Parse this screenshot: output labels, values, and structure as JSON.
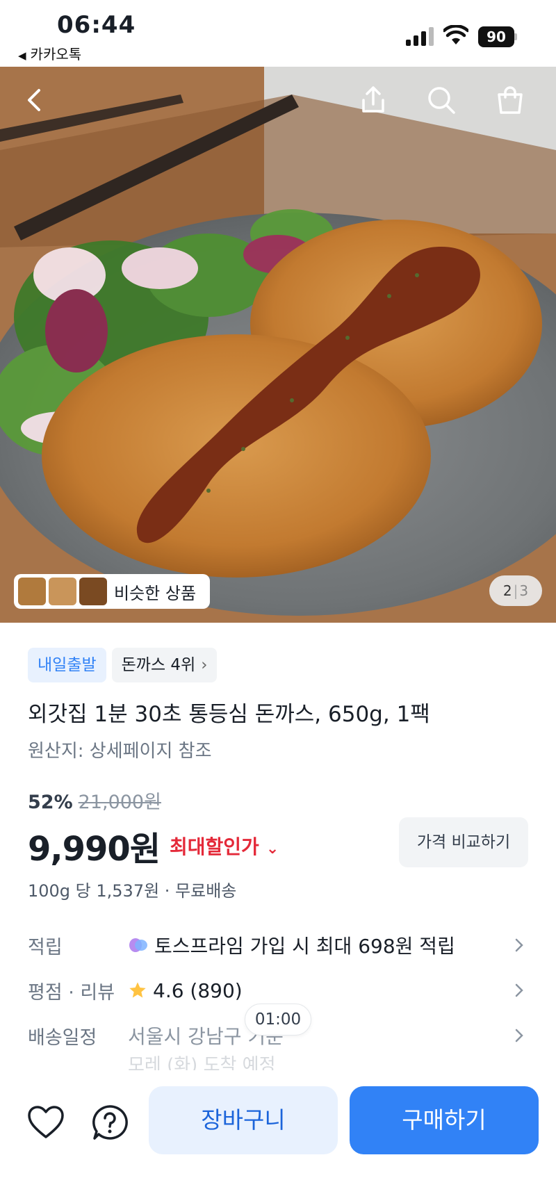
{
  "status_bar": {
    "time": "06:44",
    "back_app": "카카오톡",
    "battery": "90"
  },
  "hero": {
    "icons": [
      "back-arrow-icon",
      "share-icon",
      "search-icon",
      "shopping-bag-icon"
    ],
    "similar_label": "비슷한 상품",
    "page_current": "2",
    "page_total": "3"
  },
  "product": {
    "badge_delivery": "내일출발",
    "badge_rank": "돈까스 4위",
    "title": "외갓집 1분 30초 통등심 돈까스, 650g, 1팩",
    "origin": "원산지: 상세페이지 참조",
    "discount_pct": "52%",
    "original_price": "21,000원",
    "price": "9,990원",
    "lowest_label": "최대할인가",
    "compare_label": "가격 비교하기",
    "unit_price": "100g 당 1,537원 · 무료배송"
  },
  "info": {
    "points_label": "적립",
    "points_value": "토스프라임 가입 시 최대 698원 적립",
    "rating_label": "평점 · 리뷰",
    "rating_value": "4.6 (890)",
    "shipping_label": "배송일정",
    "shipping_value": "서울시 강남구 기준",
    "shipping_eta": "모레 (화) 도착 예정"
  },
  "timer": "01:00",
  "bottom_bar": {
    "cart_label": "장바구니",
    "buy_label": "구매하기"
  },
  "colors": {
    "accent": "#3182f6",
    "accent_light": "#e8f1fe",
    "sale_red": "#e42939"
  }
}
